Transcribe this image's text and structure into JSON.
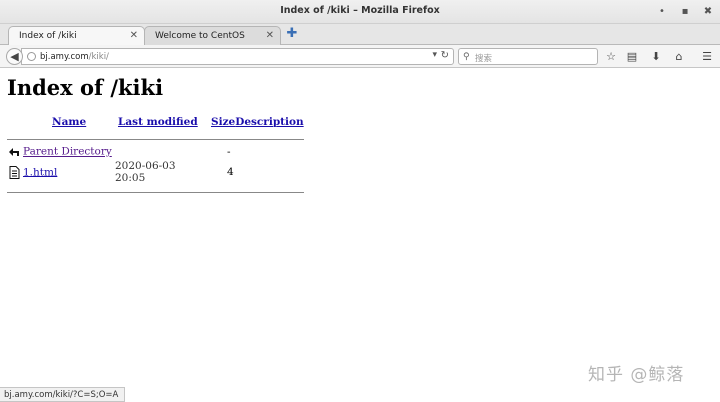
{
  "window": {
    "title": "Index of /kiki – Mozilla Firefox",
    "min_glyph": "•",
    "max_glyph": "▪",
    "close_glyph": "✖"
  },
  "tabs": [
    {
      "label": "Index of /kiki",
      "active": true
    },
    {
      "label": "Welcome to CentOS",
      "active": false
    }
  ],
  "nav": {
    "url_host": "bj.amy.com",
    "url_path": "/kiki/",
    "search_placeholder": "搜索"
  },
  "page": {
    "title": "Index of /kiki",
    "columns": {
      "name": "Name",
      "last_modified": "Last modified",
      "size": "Size",
      "description": "Description"
    },
    "rows": [
      {
        "name": "Parent Directory",
        "modified": "",
        "size": "-",
        "description": "",
        "icon": "back-icon"
      },
      {
        "name": "1.html",
        "modified": "2020-06-03 20:05",
        "size": "4",
        "description": "",
        "icon": "file-icon"
      }
    ]
  },
  "status": {
    "text": "bj.amy.com/kiki/?C=S;O=A"
  },
  "watermark": {
    "text": "知乎 @鲸落"
  },
  "colors": {
    "link": "#1a0dab",
    "visited": "#551a8b"
  }
}
